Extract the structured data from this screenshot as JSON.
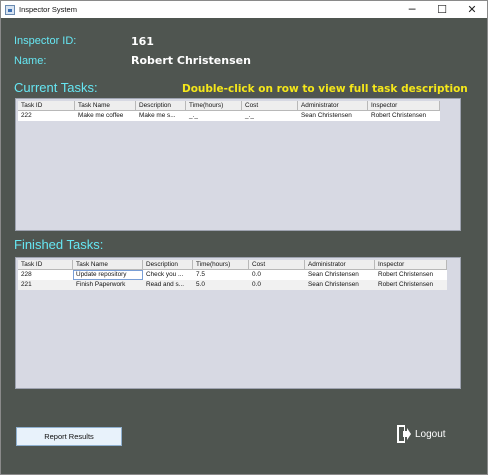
{
  "window": {
    "title": "Inspector System",
    "minimize": "─",
    "maximize": "☐",
    "close": "✕"
  },
  "inspector": {
    "id_label": "Inspector ID:",
    "id_value": "161",
    "name_label": "Name:",
    "name_value": "Robert Christensen"
  },
  "current_tasks": {
    "title": "Current Tasks:",
    "hint": "Double-click on row to view full task description",
    "columns": [
      "Task ID",
      "Task Name",
      "Description",
      "Time(hours)",
      "Cost",
      "Administrator",
      "Inspector"
    ],
    "rows": [
      [
        "222",
        "Make me coffee",
        "Make me s...",
        "_._",
        "_._",
        "Sean Christensen",
        "Robert Christensen"
      ]
    ]
  },
  "finished_tasks": {
    "title": "Finished Tasks:",
    "columns": [
      "Task ID",
      "Task Name",
      "Description",
      "Time(hours)",
      "Cost",
      "Administrator",
      "Inspector"
    ],
    "rows": [
      [
        "228",
        "Update repository",
        "Check you ...",
        "7.5",
        "0.0",
        "Sean Christensen",
        "Robert Christensen"
      ],
      [
        "221",
        "Finish Paperwork",
        "Read and s...",
        "5.0",
        "0.0",
        "Sean Christensen",
        "Robert Christensen"
      ]
    ]
  },
  "actions": {
    "report": "Report Results",
    "logout": "Logout"
  },
  "colors": {
    "background": "#4f5550",
    "label": "#66e6f2",
    "hint": "#f5e71a",
    "table_bg": "#d7d9e3"
  },
  "icons": {
    "app": "app-icon",
    "logout": "logout-icon"
  }
}
